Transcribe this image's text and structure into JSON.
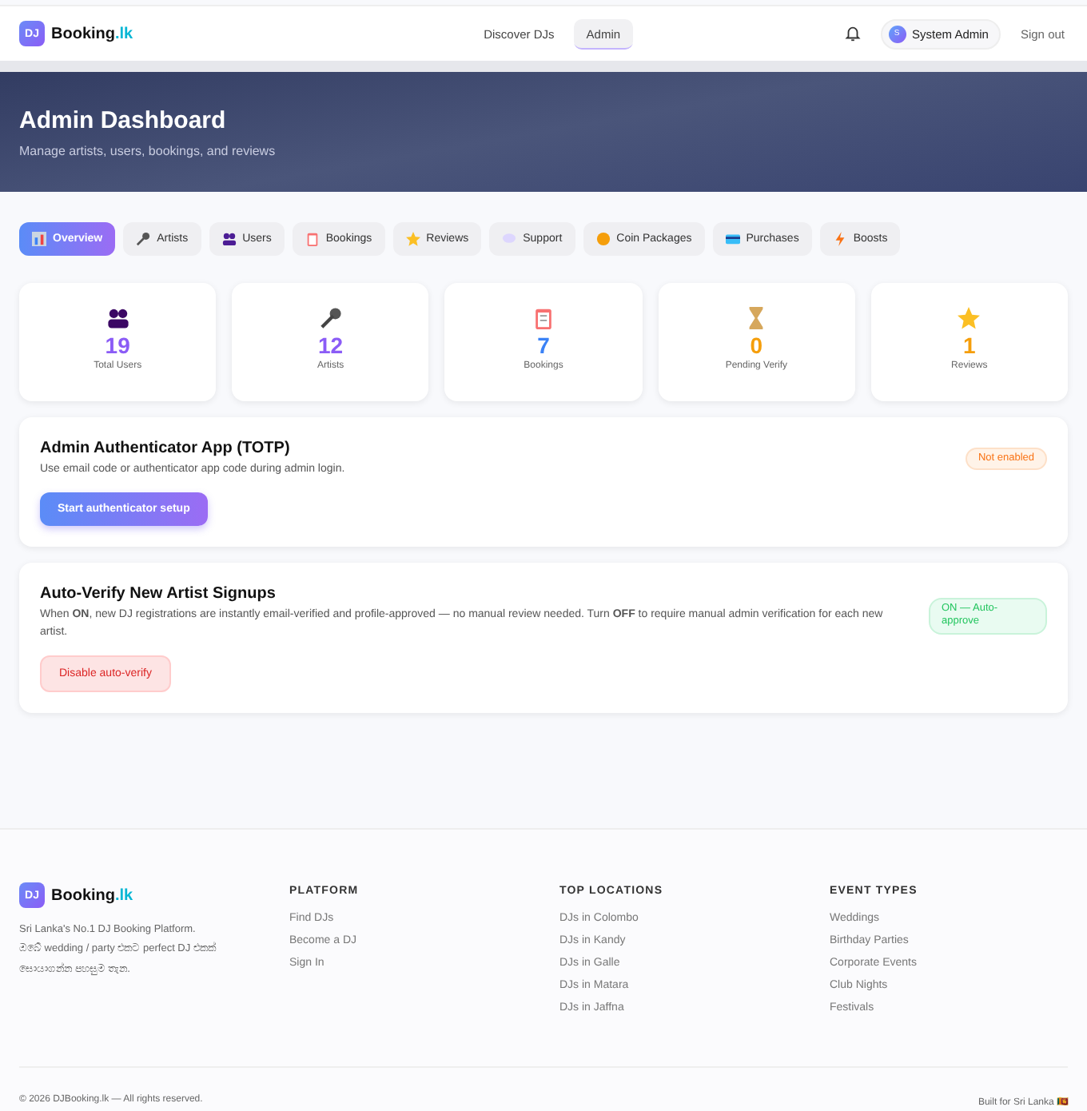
{
  "nav": {
    "logo_badge": "DJ",
    "logo_text": "Booking",
    "logo_suffix": ".lk",
    "links": [
      {
        "label": "Discover DJs",
        "selected": false
      },
      {
        "label": "Admin",
        "selected": true
      }
    ],
    "user": {
      "initial": "S",
      "name": "System Admin"
    },
    "sign_out": "Sign out"
  },
  "hero": {
    "title": "Admin Dashboard",
    "subtitle": "Manage artists, users, bookings, and reviews"
  },
  "tabs": [
    {
      "label": "Overview",
      "selected": true
    },
    {
      "label": "Artists",
      "selected": false
    },
    {
      "label": "Users",
      "selected": false
    },
    {
      "label": "Bookings",
      "selected": false
    },
    {
      "label": "Reviews",
      "selected": false
    },
    {
      "label": "Support",
      "selected": false
    },
    {
      "label": "Coin Packages",
      "selected": false
    },
    {
      "label": "Purchases",
      "selected": false
    },
    {
      "label": "Boosts",
      "selected": false
    }
  ],
  "stats": [
    {
      "value": "19",
      "label": "Total Users",
      "color": "#8b5cf6"
    },
    {
      "value": "12",
      "label": "Artists",
      "color": "#8b5cf6"
    },
    {
      "value": "7",
      "label": "Bookings",
      "color": "#3b82f6"
    },
    {
      "value": "0",
      "label": "Pending Verify",
      "color": "#f59e0b"
    },
    {
      "value": "1",
      "label": "Reviews",
      "color": "#f59e0b"
    }
  ],
  "panels": [
    {
      "title": "Admin Authenticator App (TOTP)",
      "text": "Use email code or authenticator app code during admin login.",
      "badge": "Not enabled",
      "enabled": false,
      "button": "Start authenticator setup"
    },
    {
      "title": "Auto-Verify New Artist Signups",
      "text": "When **ON**, new DJ registrations are instantly email-verified and profile-approved — no manual review needed. Turn **OFF** to require manual admin verification for each new artist.",
      "badge": "ON — Auto-approve",
      "enabled": true,
      "button": "Disable auto-verify"
    }
  ],
  "footer": {
    "logo_badge": "DJ",
    "logo_text": "Booking",
    "logo_suffix": ".lk",
    "tagline": "Sri Lanka's No.1 DJ Booking Platform.",
    "tagline_local": "ඔබේ wedding / party එකට perfect DJ එකක් සොයාගන්න පහසුම තැන.",
    "columns": [
      {
        "heading": "PLATFORM",
        "links": [
          "Find DJs",
          "Become a DJ",
          "Sign In"
        ]
      },
      {
        "heading": "TOP LOCATIONS",
        "links": [
          "DJs in Colombo",
          "DJs in Kandy",
          "DJs in Galle",
          "DJs in Matara",
          "DJs in Jaffna"
        ]
      },
      {
        "heading": "EVENT TYPES",
        "links": [
          "Weddings",
          "Birthday Parties",
          "Corporate Events",
          "Club Nights",
          "Festivals"
        ]
      }
    ],
    "copyright": "© 2026 DJBooking.lk — All rights reserved.",
    "built": "Built for Sri Lanka 🇱🇰"
  }
}
